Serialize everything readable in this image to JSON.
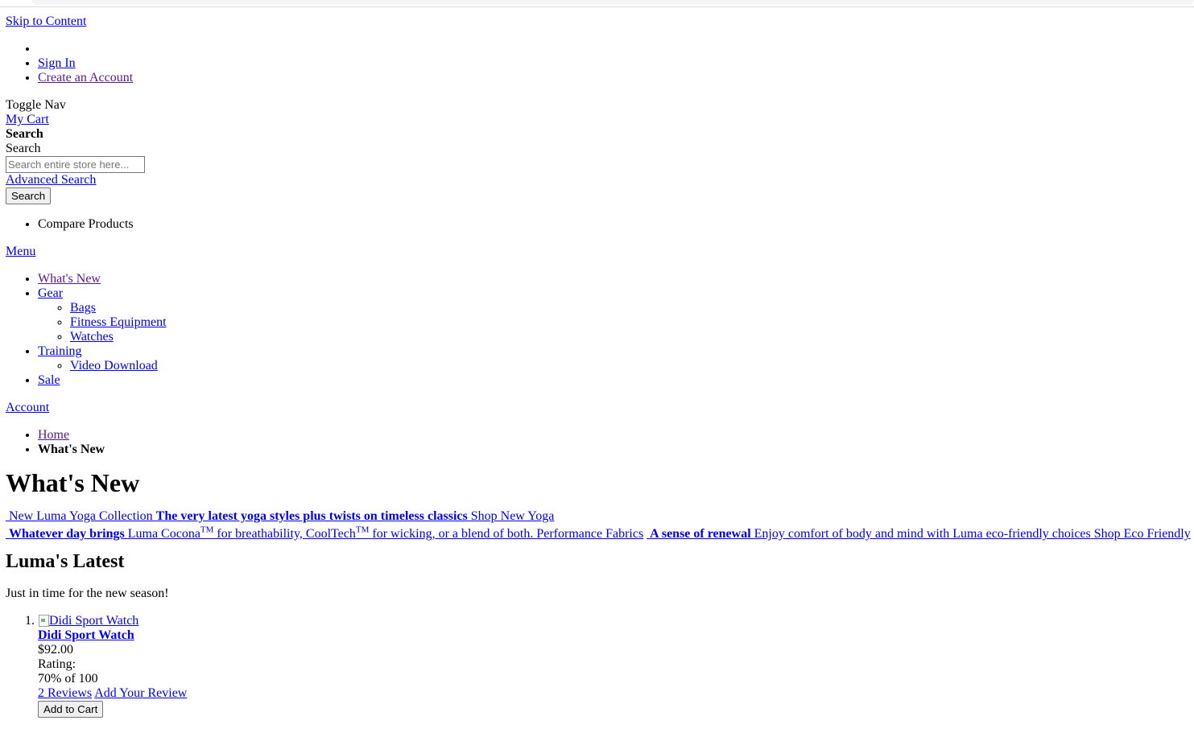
{
  "header": {
    "skip_link": "Skip to Content",
    "account_links": [
      "",
      "Sign In",
      "Create an Account"
    ],
    "toggle_nav": "Toggle Nav",
    "my_cart": "My Cart",
    "search_title": "Search",
    "search_label": "Search",
    "search_placeholder": "Search entire store here...",
    "advanced_search": "Advanced Search",
    "search_button": "Search",
    "compare_products": "Compare Products"
  },
  "menu": {
    "menu_label": "Menu",
    "items": [
      {
        "label": "What's New",
        "children": []
      },
      {
        "label": "Gear",
        "children": [
          "Bags",
          "Fitness Equipment",
          "Watches"
        ]
      },
      {
        "label": "Training",
        "children": [
          "Video Download"
        ]
      },
      {
        "label": "Sale",
        "children": []
      }
    ],
    "account_label": "Account"
  },
  "breadcrumbs": {
    "home": "Home",
    "current": "What's New"
  },
  "page_title": "What's New",
  "promos": {
    "yoga": {
      "title": "New Luma Yoga Collection",
      "headline": "The very latest yoga styles plus twists on timeless classics",
      "cta": "Shop New Yoga"
    },
    "eco": {
      "headline1": "Whatever day brings",
      "text1a": "Luma Cocona",
      "tm1": "TM",
      "text1b": " for breathability, CoolTech",
      "tm2": "TM",
      "text1c": " for wicking, or a blend of both.",
      "text1d": "Performance Fabrics",
      "headline2": "A sense of renewal",
      "text2": "Enjoy comfort of body and mind with Luma eco-friendly choices",
      "cta": "Shop Eco Friendly"
    }
  },
  "latest": {
    "heading": "Luma's Latest",
    "subtitle": "Just in time for the new season!",
    "products": [
      {
        "image_alt": "Didi Sport Watch",
        "name": "Didi Sport Watch",
        "price": "$92.00",
        "rating_label": "Rating:",
        "rating_value": "70% of 100",
        "reviews": "2  Reviews",
        "add_review": "Add Your Review",
        "add_to_cart": "Add to Cart"
      }
    ]
  }
}
